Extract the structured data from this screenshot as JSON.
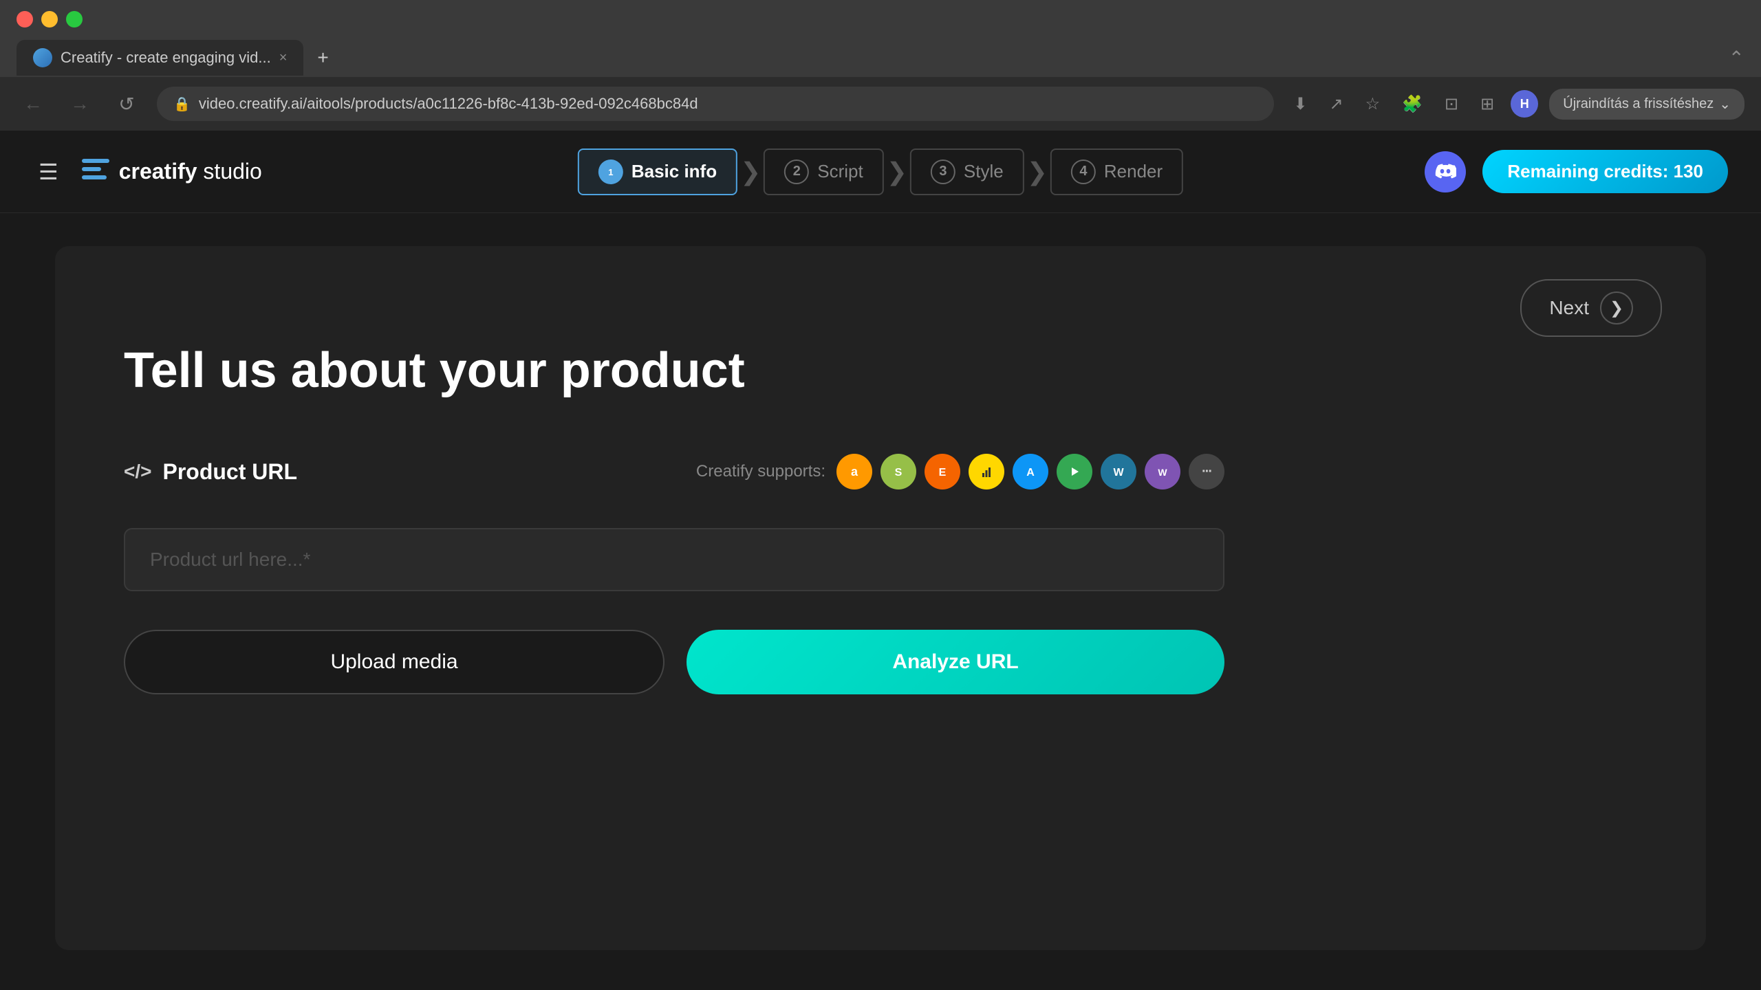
{
  "browser": {
    "traffic_lights": [
      "red",
      "yellow",
      "green"
    ],
    "tab_title": "Creatify - create engaging vid...",
    "tab_close": "×",
    "tab_new": "+",
    "back_label": "←",
    "forward_label": "→",
    "refresh_label": "↺",
    "address": "video.creatify.ai/aitools/products/a0c11226-bf8c-413b-92ed-092c468bc84d",
    "refresh_button_text": "Újraindítás a frissítéshez",
    "profile_initial": "H"
  },
  "header": {
    "hamburger_label": "☰",
    "logo_brand": "creatify",
    "logo_suffix": " studio",
    "discord_icon": "💬",
    "credits_label": "Remaining credits: 130"
  },
  "steps": [
    {
      "id": 1,
      "label": "Basic info",
      "active": true
    },
    {
      "id": 2,
      "label": "Script",
      "active": false
    },
    {
      "id": 3,
      "label": "Style",
      "active": false
    },
    {
      "id": 4,
      "label": "Render",
      "active": false
    }
  ],
  "main": {
    "next_label": "Next",
    "page_title": "Tell us about your product",
    "product_url_label": "Product URL",
    "product_url_icon": "</>",
    "supports_text": "Creatify supports:",
    "platforms": [
      {
        "name": "amazon",
        "letter": "A",
        "color": "#ff9900"
      },
      {
        "name": "shopify",
        "letter": "S",
        "color": "#96bf48"
      },
      {
        "name": "etsy",
        "letter": "E",
        "color": "#f56400"
      },
      {
        "name": "bar-charts",
        "letter": "📊",
        "color": "#444"
      },
      {
        "name": "app-store",
        "letter": "A",
        "color": "#0d96f6"
      },
      {
        "name": "google-play",
        "letter": "▶",
        "color": "#34a853"
      },
      {
        "name": "wordpress",
        "letter": "W",
        "color": "#21759b"
      },
      {
        "name": "woocommerce",
        "letter": "W",
        "color": "#7f54b3"
      },
      {
        "name": "more",
        "letter": "···",
        "color": "#444"
      }
    ],
    "url_placeholder": "Product url here...*",
    "upload_media_label": "Upload media",
    "analyze_url_label": "Analyze URL"
  }
}
